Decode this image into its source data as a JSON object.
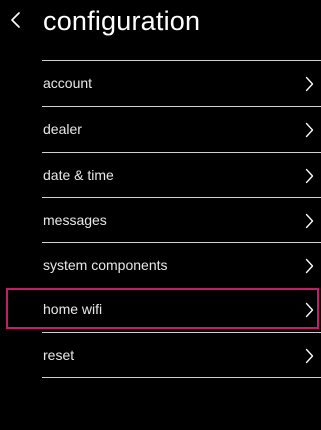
{
  "header": {
    "title": "configuration",
    "back_icon": "chevron-left-icon"
  },
  "menu": {
    "items": [
      {
        "id": "account",
        "label": "account",
        "icon": "chevron-right-icon"
      },
      {
        "id": "dealer",
        "label": "dealer",
        "icon": "chevron-right-icon"
      },
      {
        "id": "date-time",
        "label": "date & time",
        "icon": "chevron-right-icon"
      },
      {
        "id": "messages",
        "label": "messages",
        "icon": "chevron-right-icon"
      },
      {
        "id": "system-components",
        "label": "system components",
        "icon": "chevron-right-icon"
      },
      {
        "id": "home-wifi",
        "label": "home wifi",
        "icon": "chevron-right-icon",
        "highlighted": true
      },
      {
        "id": "reset",
        "label": "reset",
        "icon": "chevron-right-icon"
      }
    ]
  },
  "colors": {
    "background": "#000000",
    "text": "#ffffff",
    "divider": "#cfcfcf",
    "highlight": "#c21e6a"
  }
}
